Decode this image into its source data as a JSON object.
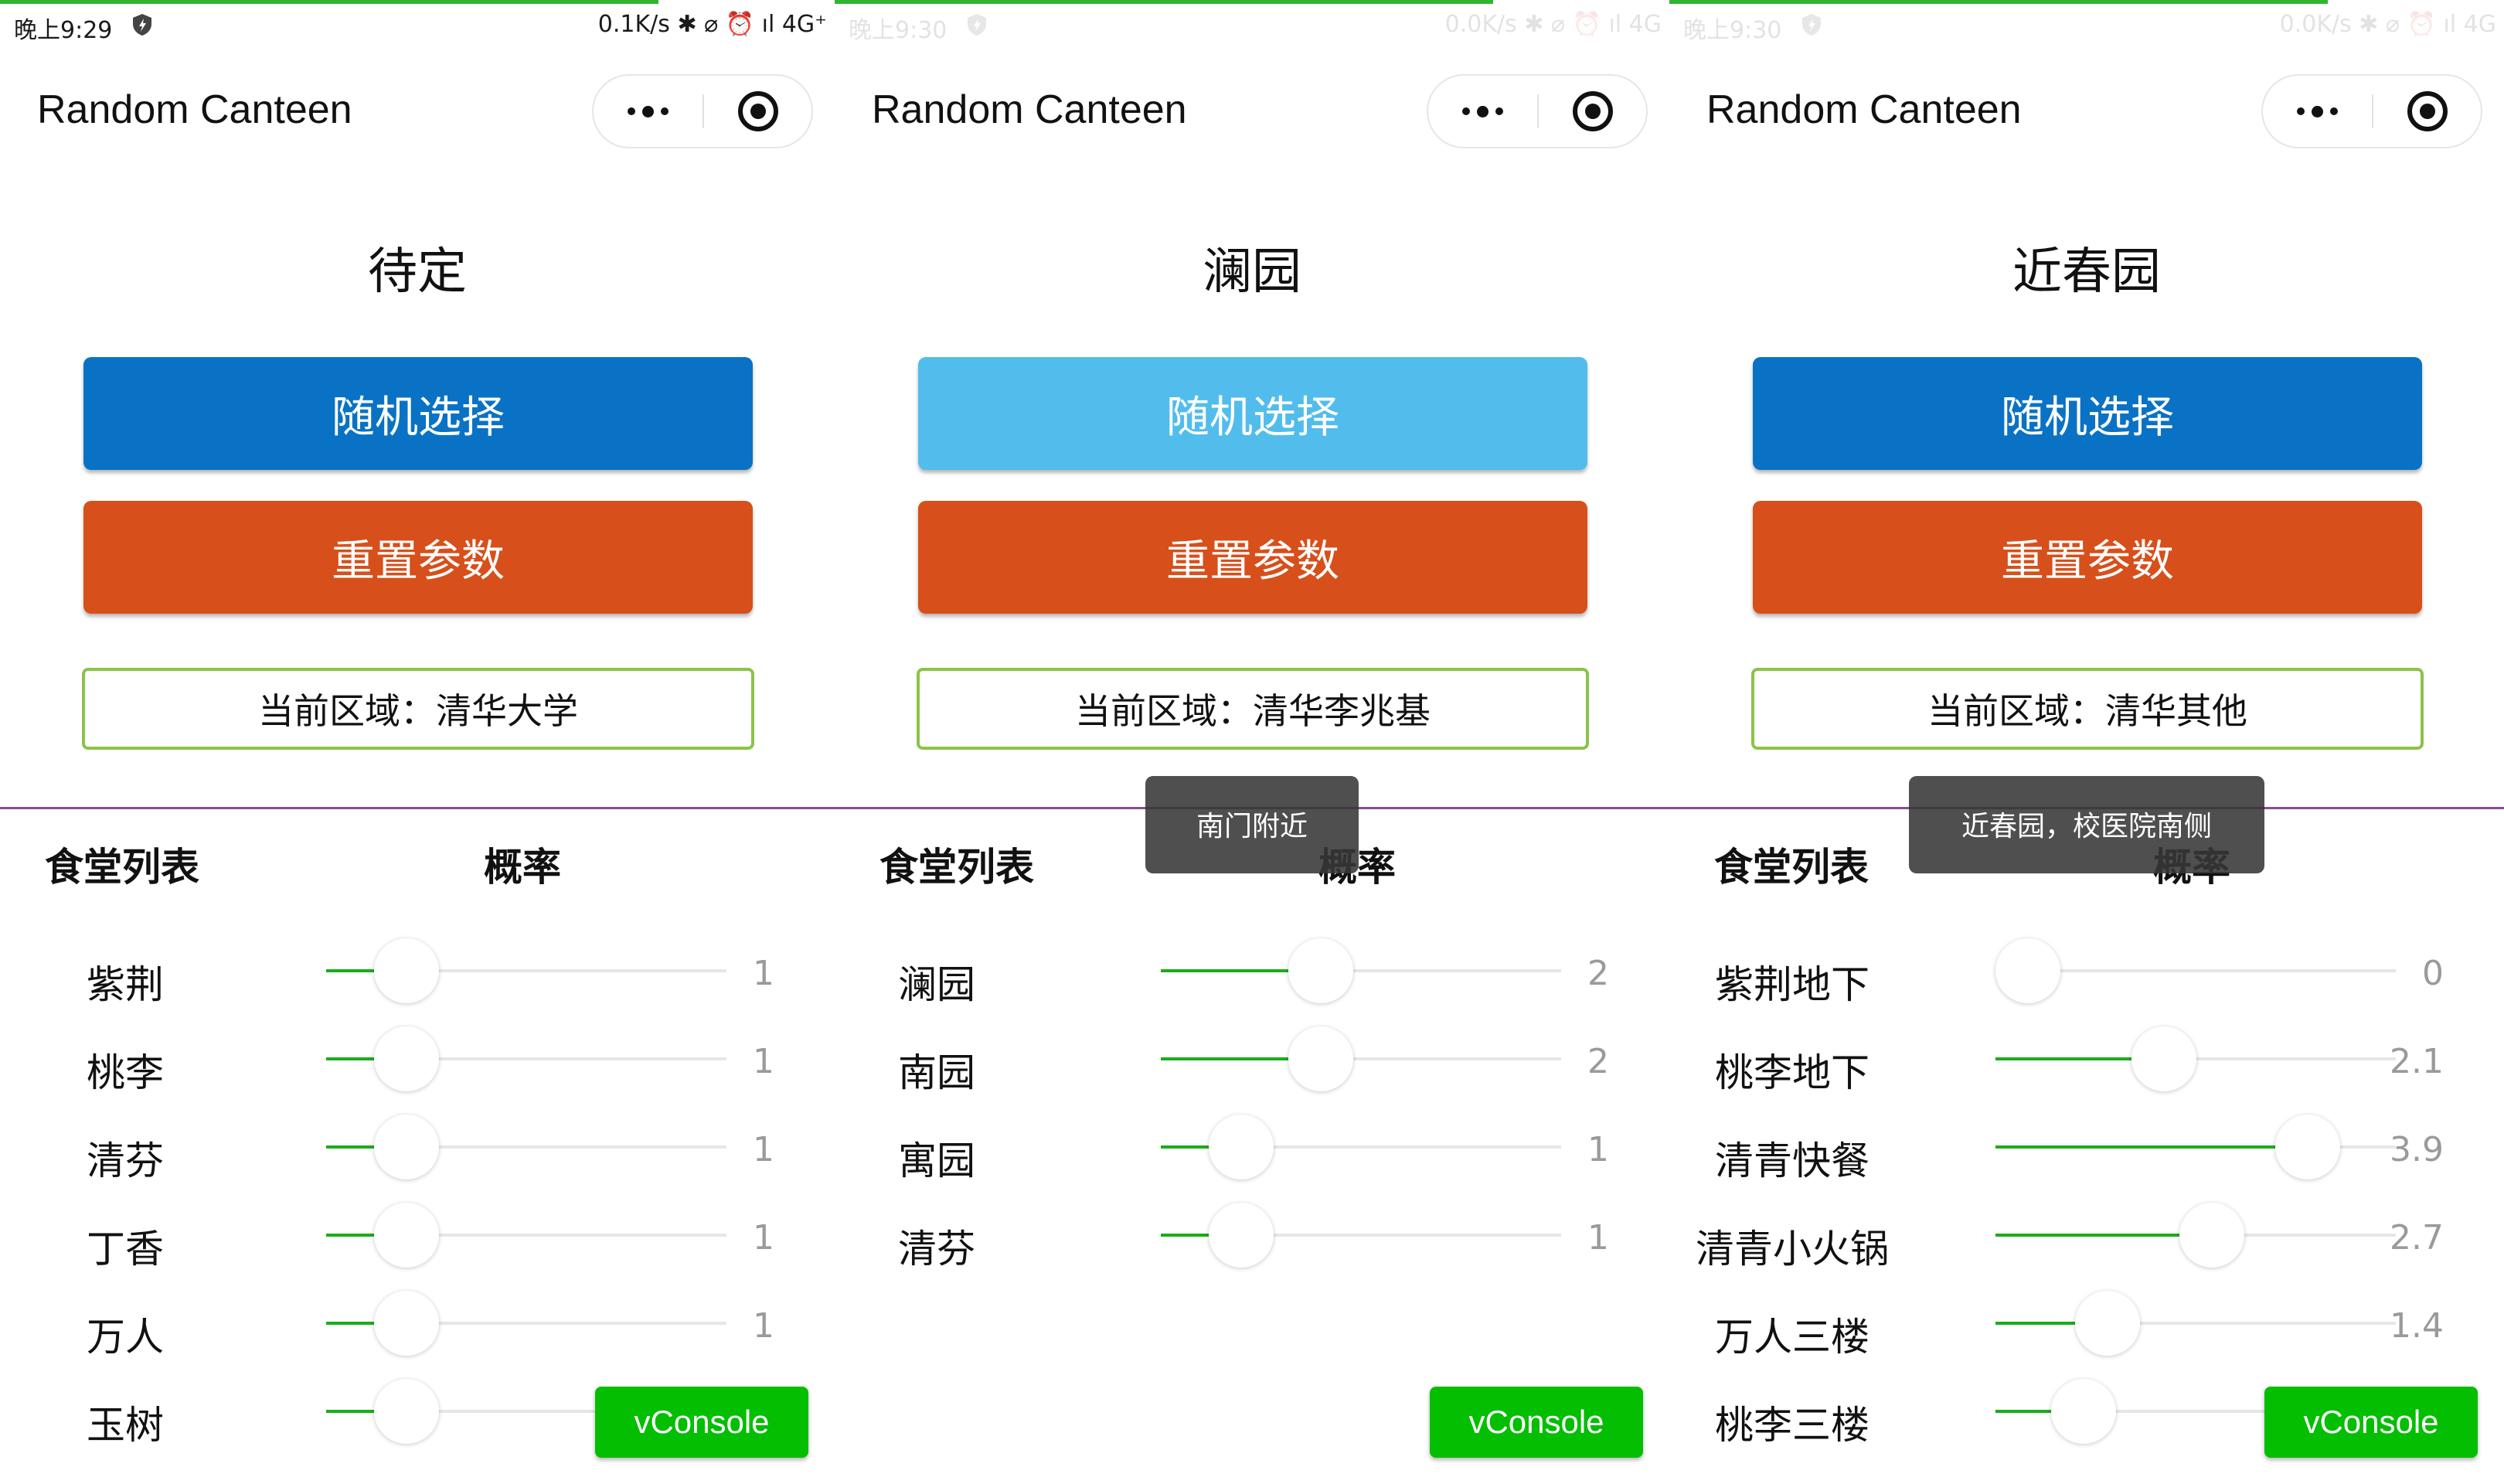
{
  "colors": {
    "accent_green": "#1aad19",
    "random_button": "#0a72c4",
    "random_button_pressed": "#52bdec",
    "reset_button": "#d74f1a",
    "region_border": "#8bc34a",
    "vconsole": "#04be02",
    "divider": "#8a4a94"
  },
  "panels": [
    {
      "status": {
        "time": "晚上9:29",
        "right": "0.1K/s ✱ ⌀ ⏰ ıl 4G⁺"
      },
      "app_title": "Random Canteen",
      "result": "待定",
      "random_label": "随机选择",
      "reset_label": "重置参数",
      "region": "当前区域：清华大学",
      "list_header_name": "食堂列表",
      "list_header_prob": "概率",
      "toast": "",
      "vconsole_label": "vConsole",
      "canteens": [
        {
          "name": "紫荆",
          "value": "1",
          "fraction": 0.2
        },
        {
          "name": "桃李",
          "value": "1",
          "fraction": 0.2
        },
        {
          "name": "清芬",
          "value": "1",
          "fraction": 0.2
        },
        {
          "name": "丁香",
          "value": "1",
          "fraction": 0.2
        },
        {
          "name": "万人",
          "value": "1",
          "fraction": 0.2
        },
        {
          "name": "玉树",
          "value": "1",
          "fraction": 0.2
        }
      ]
    },
    {
      "status": {
        "time": "晚上9:30",
        "right": "0.0K/s ✱ ⌀ ⏰ ıl 4G"
      },
      "app_title": "Random Canteen",
      "result": "澜园",
      "random_label": "随机选择",
      "reset_label": "重置参数",
      "region": "当前区域：清华李兆基",
      "list_header_name": "食堂列表",
      "list_header_prob": "概率",
      "toast": "南门附近",
      "vconsole_label": "vConsole",
      "canteens": [
        {
          "name": "澜园",
          "value": "2",
          "fraction": 0.4
        },
        {
          "name": "南园",
          "value": "2",
          "fraction": 0.4
        },
        {
          "name": "寓园",
          "value": "1",
          "fraction": 0.2
        },
        {
          "name": "清芬",
          "value": "1",
          "fraction": 0.2
        }
      ]
    },
    {
      "status": {
        "time": "晚上9:30",
        "right": "0.0K/s ✱ ⌀ ⏰ ıl 4G"
      },
      "app_title": "Random Canteen",
      "result": "近春园",
      "random_label": "随机选择",
      "reset_label": "重置参数",
      "region": "当前区域：清华其他",
      "list_header_name": "食堂列表",
      "list_header_prob": "概率",
      "toast": "近春园，校医院南侧",
      "vconsole_label": "vConsole",
      "canteens": [
        {
          "name": "紫荆地下",
          "value": "0",
          "fraction": 0.0
        },
        {
          "name": "桃李地下",
          "value": "2.1",
          "fraction": 0.42
        },
        {
          "name": "清青快餐",
          "value": "3.9",
          "fraction": 0.78
        },
        {
          "name": "清青小火锅",
          "value": "2.7",
          "fraction": 0.54
        },
        {
          "name": "万人三楼",
          "value": "1.4",
          "fraction": 0.28
        },
        {
          "name": "桃李三楼",
          "value": "",
          "fraction": 0.22
        }
      ]
    }
  ]
}
